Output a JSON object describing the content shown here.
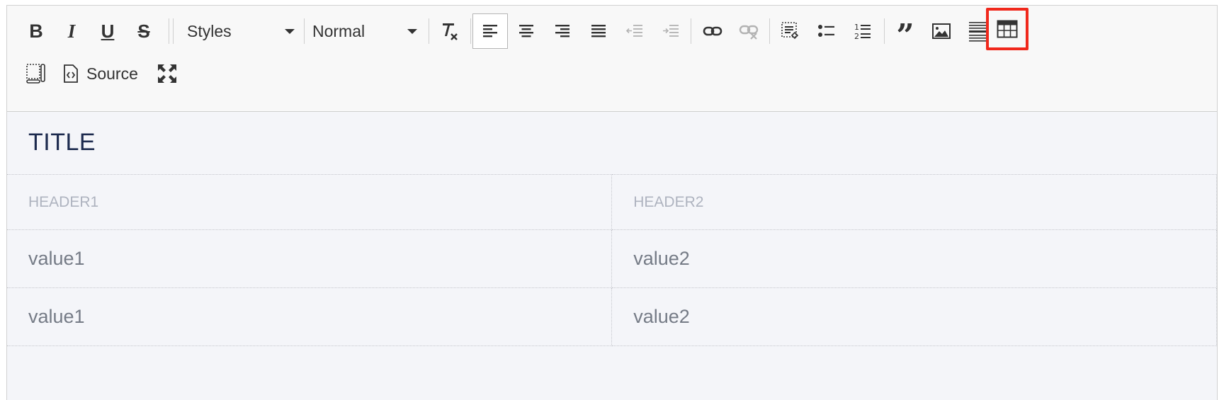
{
  "toolbar": {
    "bold": "B",
    "italic": "I",
    "underline": "U",
    "strike": "S",
    "styles_label": "Styles",
    "format_label": "Normal",
    "source_label": "Source"
  },
  "document": {
    "title": "TITLE",
    "table": {
      "headers": [
        "HEADER1",
        "HEADER2"
      ],
      "rows": [
        [
          "value1",
          "value2"
        ],
        [
          "value1",
          "value2"
        ]
      ]
    }
  },
  "colors": {
    "highlight": "#f0281c",
    "title_text": "#1c2a4e",
    "header_text": "#aeb3bf",
    "cell_text": "#757b86",
    "content_bg": "#f4f5f9"
  }
}
